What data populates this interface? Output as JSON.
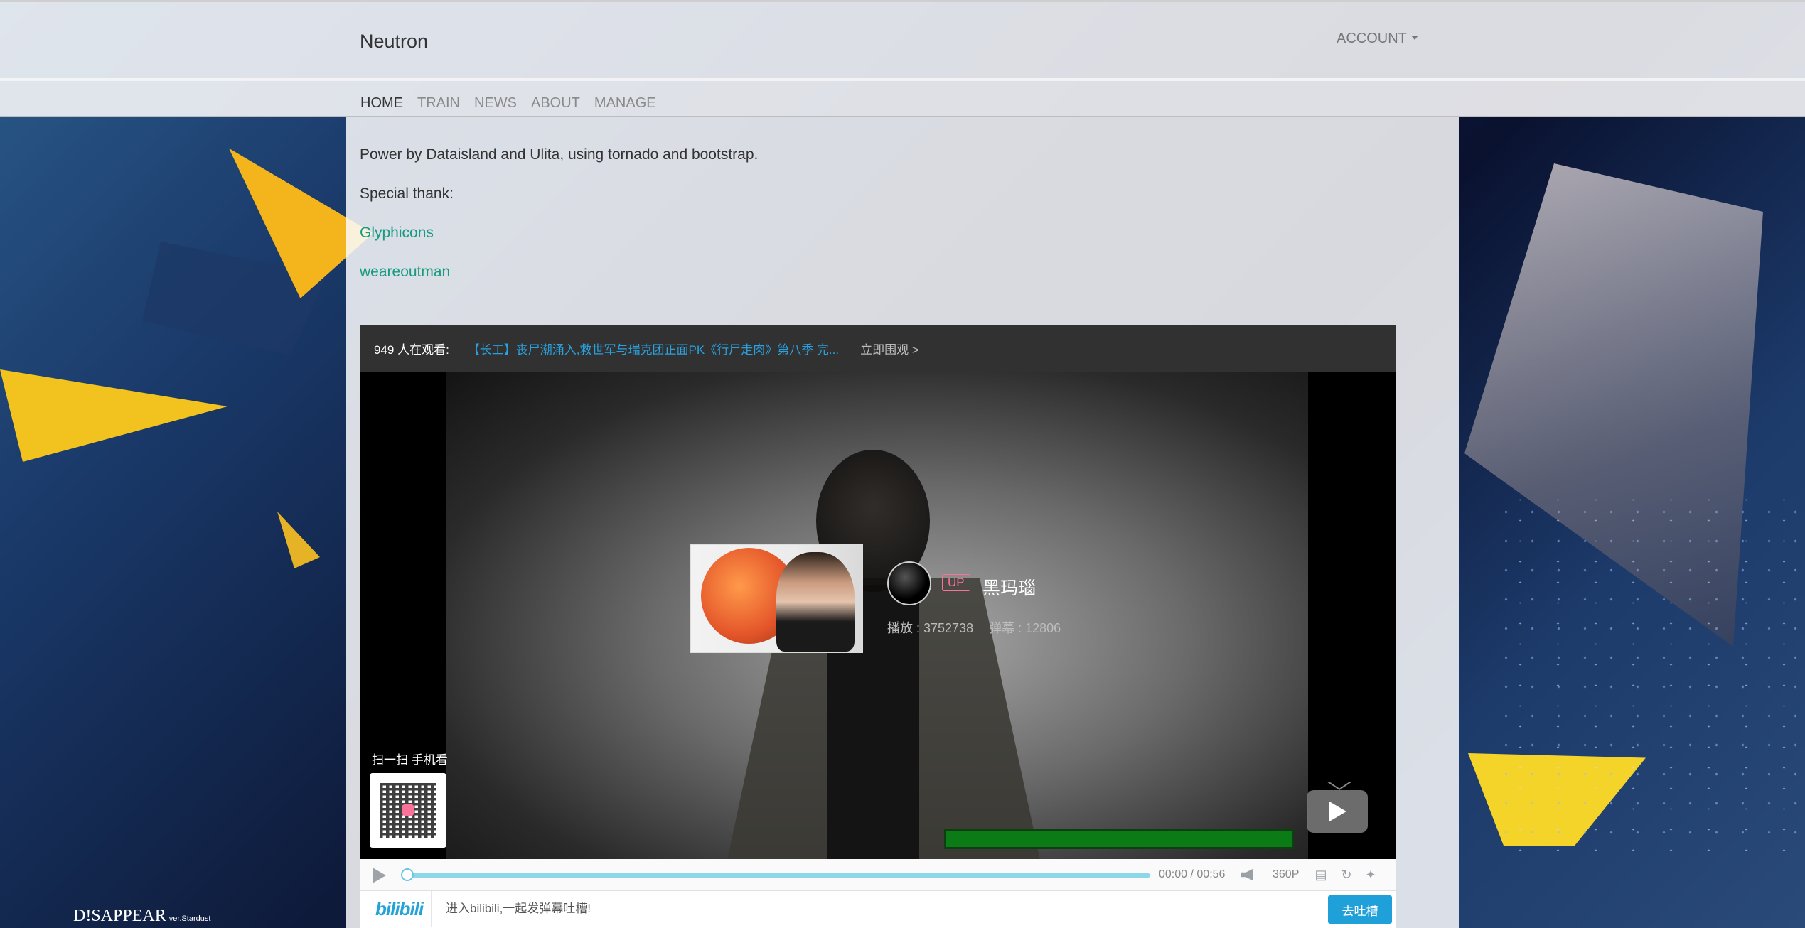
{
  "header": {
    "brand": "Neutron",
    "account_label": "ACCOUNT",
    "nav": [
      "HOME",
      "TRAIN",
      "NEWS",
      "ABOUT",
      "MANAGE"
    ],
    "active_nav": "HOME"
  },
  "content": {
    "powered_by": "Power by Dataisland and Ulita, using tornado and bootstrap.",
    "special_thanks_label": "Special thank:",
    "links": [
      "Glyphicons",
      "weareoutman"
    ]
  },
  "player": {
    "live_count": "949 人在观看:",
    "live_title": "【长工】丧尸潮涌入,救世军与瑞克团正面PK《行尸走肉》第八季 完...",
    "live_go": "立即围观 >",
    "up_badge": "UP",
    "uploader": "黑玛瑙",
    "plays": "播放 : 3752738",
    "danmaku_count": "弹幕 : 12806",
    "qr_label": "扫一扫 手机看",
    "time_current": "00:00",
    "time_separator": "/",
    "time_total": "00:56",
    "quality": "360P",
    "progress_fraction": 0.0,
    "logo_text": "bilibili",
    "danmaku_placeholder": "进入bilibili,一起发弹幕吐槽!",
    "send_label": "去吐槽"
  },
  "watermark": {
    "title": "D!SAPPEAR",
    "version": "ver.Stardust"
  },
  "colors": {
    "link": "#179b80",
    "live_title": "#2aa1de",
    "up_badge": "#fb7299",
    "send_button": "#20a0d8",
    "progress": "#8ed6ea"
  }
}
